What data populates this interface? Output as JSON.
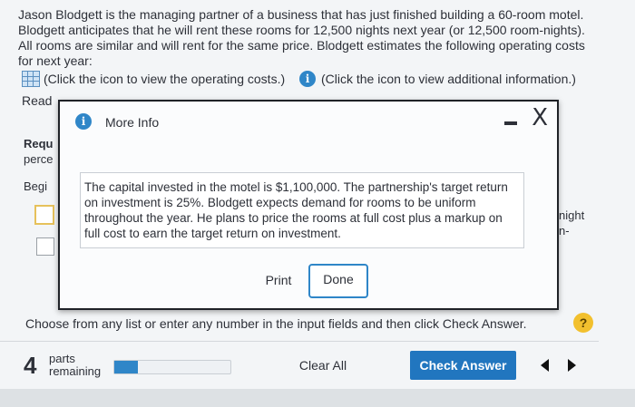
{
  "question": {
    "paragraph": "Jason Blodgett is the managing partner of a business that has just finished building a 60-room motel. Blodgett anticipates that he will rent these rooms for 12,500 nights next year (or 12,500 room-nights). All rooms are similar and will rent for the same price. Blodgett estimates the following operating costs for next year:"
  },
  "links": {
    "operating_costs": "(Click the icon to view the operating costs.)",
    "additional_info": "(Click the icon to view additional information.)"
  },
  "background_fragments": {
    "read": "Read",
    "requ": "Requ",
    "perce": "perce",
    "begin": "Begi",
    "night": "night",
    "n_dash": "n-"
  },
  "modal": {
    "title": "More Info",
    "info_glyph": "i",
    "close_glyph": "X",
    "body": "The capital invested in the motel is $1,100,000. The partnership's target return on investment is 25%. Blodgett expects demand for rooms to be uniform throughout the year. He plans to price the rooms at full cost plus a markup on full cost to earn the target return on investment.",
    "print_label": "Print",
    "done_label": "Done"
  },
  "footer": {
    "instruction": "Choose from any list or enter any number in the input fields and then click Check Answer.",
    "help_glyph": "?",
    "parts_count": "4",
    "parts_label_1": "parts",
    "parts_label_2": "remaining",
    "progress_fraction": 0.2,
    "clear_all": "Clear All",
    "check_answer": "Check Answer"
  },
  "colors": {
    "accent": "#2176bf",
    "help": "#f2c02e",
    "highlight_box": "#e6c15b"
  }
}
